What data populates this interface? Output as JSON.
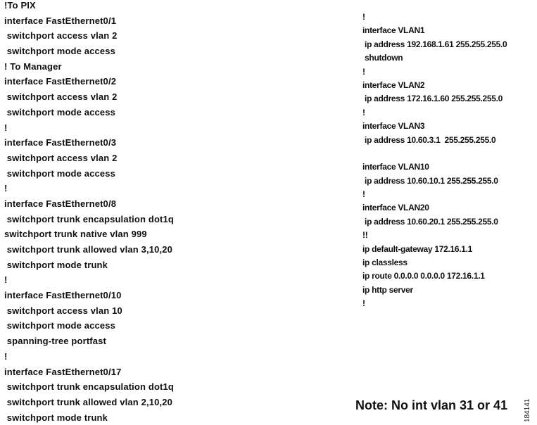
{
  "left_config": [
    "!To PIX",
    "interface FastEthernet0/1",
    " switchport access vlan 2",
    " switchport mode access",
    "! To Manager",
    "interface FastEthernet0/2",
    " switchport access vlan 2",
    " switchport mode access",
    "!",
    "interface FastEthernet0/3",
    " switchport access vlan 2",
    " switchport mode access",
    "!",
    "interface FastEthernet0/8",
    " switchport trunk encapsulation dot1q",
    "switchport trunk native vlan 999",
    " switchport trunk allowed vlan 3,10,20",
    " switchport mode trunk",
    "!",
    "interface FastEthernet0/10",
    " switchport access vlan 10",
    " switchport mode access",
    " spanning-tree portfast",
    "!",
    "interface FastEthernet0/17",
    " switchport trunk encapsulation dot1q",
    " switchport trunk allowed vlan 2,10,20",
    " switchport mode trunk"
  ],
  "right_config": [
    "!",
    "interface VLAN1",
    " ip address 192.168.1.61 255.255.255.0",
    " shutdown",
    "!",
    "interface VLAN2",
    " ip address 172.16.1.60 255.255.255.0",
    "!",
    "interface VLAN3",
    " ip address 10.60.3.1  255.255.255.0",
    "",
    "interface VLAN10",
    " ip address 10.60.10.1 255.255.255.0",
    "!",
    "interface VLAN20",
    " ip address 10.60.20.1 255.255.255.0",
    "!!",
    "ip default-gateway 172.16.1.1",
    "ip classless",
    "ip route 0.0.0.0 0.0.0.0 172.16.1.1",
    "ip http server",
    "!"
  ],
  "note": "Note: No int vlan 31 or 41",
  "figure_id": "184141"
}
